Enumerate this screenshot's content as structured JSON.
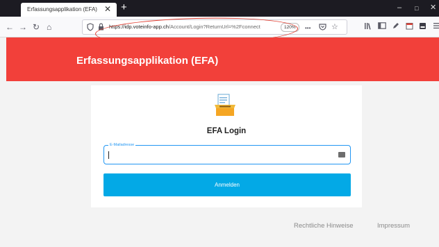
{
  "browser": {
    "tab_title": "Erfassungsapplikation (EFA)",
    "tab_close": "✕",
    "new_tab": "+",
    "window_controls": {
      "minimize": "–",
      "maximize": "□",
      "close": "✕"
    },
    "nav": {
      "back": "←",
      "forward": "→",
      "reload": "↻",
      "home": "⌂"
    },
    "url": {
      "host": "https://idp.voteinfo-app.ch",
      "path": "/Account/Login?ReturnUrl=%2Fconnect",
      "zoom": "120%",
      "page_actions": "•••"
    },
    "annotation_color": "#e23c2e"
  },
  "header": {
    "title": "Erfassungsapplikation (EFA)",
    "background": "#f2403a"
  },
  "login": {
    "title": "EFA Login",
    "email_label": "E-Mailadresse",
    "email_value": "",
    "submit_label": "Anmelden",
    "accent": "#2196f3",
    "button_color": "#03a9e6"
  },
  "footer": {
    "legal_link": "Rechtliche Hinweise",
    "imprint_link": "Impressum"
  }
}
